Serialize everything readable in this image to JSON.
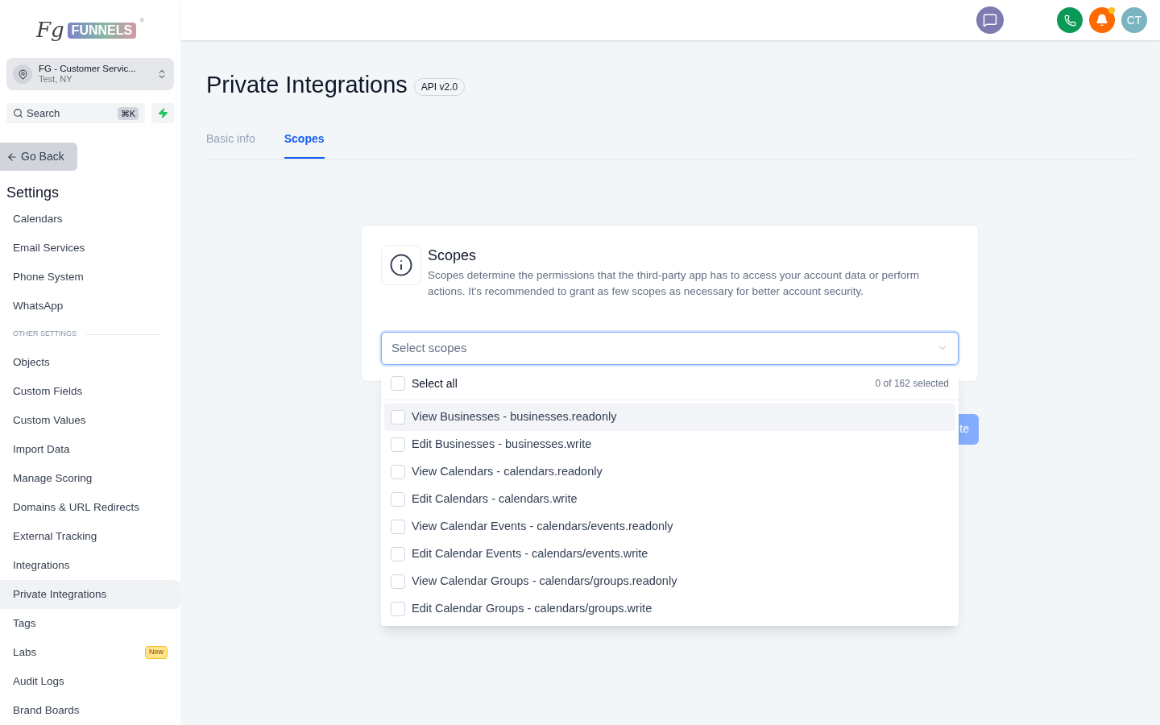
{
  "logo": {
    "mark": "Fg",
    "name": "FUNNELS",
    "registered": "®"
  },
  "account": {
    "name": "FG - Customer Servic...",
    "location": "Test, NY"
  },
  "search": {
    "placeholder": "Search",
    "shortcut": "⌘K"
  },
  "go_back": "Go Back",
  "sidebar": {
    "title": "Settings",
    "items": [
      {
        "kind": "item",
        "label": "Calendars",
        "selected": false
      },
      {
        "kind": "item",
        "label": "Email Services",
        "selected": false
      },
      {
        "kind": "item",
        "label": "Phone System",
        "selected": false
      },
      {
        "kind": "item",
        "label": "WhatsApp",
        "selected": false
      },
      {
        "kind": "section",
        "label": "OTHER SETTINGS"
      },
      {
        "kind": "item",
        "label": "Objects",
        "selected": false
      },
      {
        "kind": "item",
        "label": "Custom Fields",
        "selected": false
      },
      {
        "kind": "item",
        "label": "Custom Values",
        "selected": false
      },
      {
        "kind": "item",
        "label": "Import Data",
        "selected": false
      },
      {
        "kind": "item",
        "label": "Manage Scoring",
        "selected": false
      },
      {
        "kind": "item",
        "label": "Domains & URL Redirects",
        "selected": false
      },
      {
        "kind": "item",
        "label": "External Tracking",
        "selected": false
      },
      {
        "kind": "item",
        "label": "Integrations",
        "selected": false
      },
      {
        "kind": "item",
        "label": "Private Integrations",
        "selected": true
      },
      {
        "kind": "item",
        "label": "Tags",
        "selected": false
      },
      {
        "kind": "item",
        "label": "Labs",
        "selected": false,
        "badge": "New"
      },
      {
        "kind": "item",
        "label": "Audit Logs",
        "selected": false
      },
      {
        "kind": "item",
        "label": "Brand Boards",
        "selected": false
      }
    ]
  },
  "header": {
    "avatar": "CT",
    "notification_dot": true
  },
  "page": {
    "title": "Private Integrations",
    "badge": "API v2.0"
  },
  "tabs": [
    {
      "label": "Basic info",
      "selected": false
    },
    {
      "label": "Scopes",
      "selected": true
    }
  ],
  "card": {
    "title": "Scopes",
    "description": "Scopes determine the permissions that the third-party app has to access your account data or perform actions. It's recommended to grant as few scopes as necessary for better account security.",
    "select_placeholder": "Select scopes"
  },
  "dropdown": {
    "select_all": {
      "label": "Select all",
      "checked": false
    },
    "count": "0 of 162 selected",
    "options": [
      {
        "label": "View Businesses - businesses.readonly",
        "checked": false,
        "hovered": true
      },
      {
        "label": "Edit Businesses - businesses.write",
        "checked": false,
        "hovered": false
      },
      {
        "label": "View Calendars - calendars.readonly",
        "checked": false,
        "hovered": false
      },
      {
        "label": "Edit Calendars - calendars.write",
        "checked": false,
        "hovered": false
      },
      {
        "label": "View Calendar Events - calendars/events.readonly",
        "checked": false,
        "hovered": false
      },
      {
        "label": "Edit Calendar Events - calendars/events.write",
        "checked": false,
        "hovered": false
      },
      {
        "label": "View Calendar Groups - calendars/groups.readonly",
        "checked": false,
        "hovered": false
      },
      {
        "label": "Edit Calendar Groups - calendars/groups.write",
        "checked": false,
        "hovered": false
      }
    ]
  },
  "action_button": "te"
}
